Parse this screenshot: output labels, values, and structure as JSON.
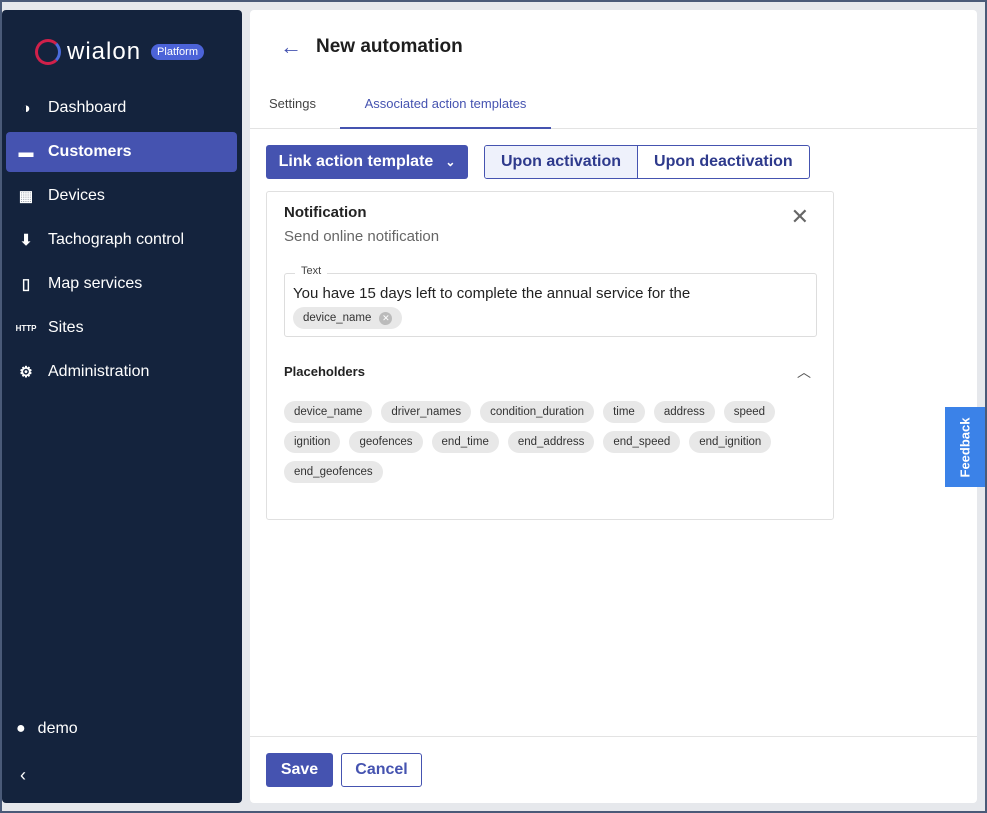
{
  "brand": {
    "name": "wialon",
    "badge": "Platform"
  },
  "sidebar": {
    "items": [
      {
        "label": "Dashboard",
        "icon": "pie-chart-icon"
      },
      {
        "label": "Customers",
        "icon": "briefcase-icon",
        "active": true
      },
      {
        "label": "Devices",
        "icon": "device-icon"
      },
      {
        "label": "Tachograph control",
        "icon": "card-download-icon"
      },
      {
        "label": "Map services",
        "icon": "map-icon"
      },
      {
        "label": "Sites",
        "icon": "http-icon",
        "icon_text": "HTTP"
      },
      {
        "label": "Administration",
        "icon": "gear-icon"
      }
    ],
    "user": "demo"
  },
  "header": {
    "title": "New automation"
  },
  "tabs": [
    {
      "label": "Settings"
    },
    {
      "label": "Associated action templates",
      "active": true
    }
  ],
  "toolbar": {
    "link_label": "Link action template",
    "segments": [
      "Upon activation",
      "Upon deactivation"
    ]
  },
  "card": {
    "title": "Notification",
    "subtitle": "Send online notification",
    "text_label": "Text",
    "text_value": "You have 15 days left to complete the annual service for the",
    "text_chip": "device_name",
    "placeholders_label": "Placeholders",
    "placeholders": [
      "device_name",
      "driver_names",
      "condition_duration",
      "time",
      "address",
      "speed",
      "ignition",
      "geofences",
      "end_time",
      "end_address",
      "end_speed",
      "end_ignition",
      "end_geofences"
    ]
  },
  "footer": {
    "save": "Save",
    "cancel": "Cancel"
  },
  "feedback": "Feedback"
}
